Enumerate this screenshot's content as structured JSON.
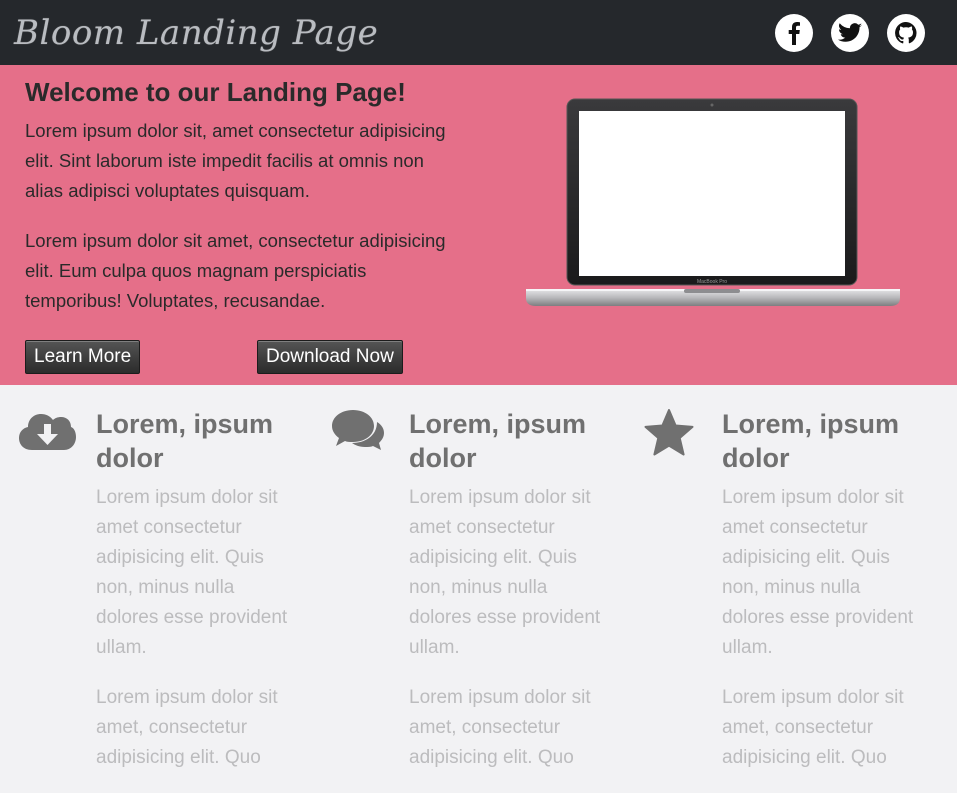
{
  "header": {
    "brand": "Bloom Landing Page",
    "social_icons": [
      "facebook-icon",
      "twitter-icon",
      "github-icon"
    ]
  },
  "hero": {
    "title": "Welcome to our Landing Page!",
    "paragraph_1": "Lorem ipsum dolor sit, amet consectetur adipisicing elit. Sint laborum iste impedit facilis at omnis non alias adipisci voluptates quisquam.",
    "paragraph_2": "Lorem ipsum dolor sit amet, consectetur adipisicing elit. Eum culpa quos magnam perspiciatis temporibus! Voluptates, recusandae.",
    "learn_more_label": "Learn More",
    "download_label": "Download Now",
    "laptop_brand_text": "MacBook Pro"
  },
  "features": [
    {
      "icon": "cloud-download-icon",
      "title": "Lorem, ipsum dolor",
      "paragraph_1": "Lorem ipsum dolor sit amet consectetur adipisicing elit. Quis non, minus nulla dolores esse provident ullam.",
      "paragraph_2": "Lorem ipsum dolor sit amet, consectetur adipisicing elit. Quo"
    },
    {
      "icon": "comments-icon",
      "title": "Lorem, ipsum dolor",
      "paragraph_1": "Lorem ipsum dolor sit amet consectetur adipisicing elit. Quis non, minus nulla dolores esse provident ullam.",
      "paragraph_2": "Lorem ipsum dolor sit amet, consectetur adipisicing elit. Quo"
    },
    {
      "icon": "star-icon",
      "title": "Lorem, ipsum dolor",
      "paragraph_1": "Lorem ipsum dolor sit amet consectetur adipisicing elit. Quis non, minus nulla dolores esse provident ullam.",
      "paragraph_2": "Lorem ipsum dolor sit amet, consectetur adipisicing elit. Quo"
    }
  ],
  "colors": {
    "header_bg": "#25282c",
    "hero_bg": "#e56f89",
    "features_bg": "#f2f2f4",
    "feature_title": "#707070",
    "feature_text": "#bcbcbe",
    "icon_gray": "#707070"
  }
}
